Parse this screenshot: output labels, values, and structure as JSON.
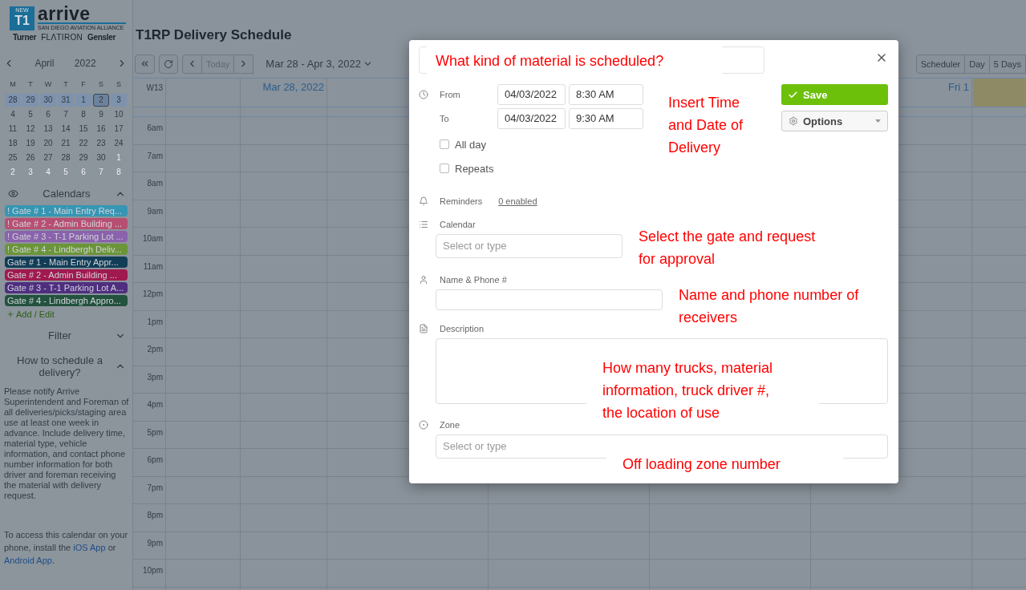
{
  "header": {
    "logo": {
      "badge_top": "NEW",
      "badge": "T1",
      "name": "arrive",
      "tagline": "SAN DIEGO AVIATION ALLIANCE",
      "partners": [
        "Turner",
        "FLΛTIRON",
        "Gensler"
      ]
    },
    "title": "T1RP Delivery Schedule"
  },
  "mini_calendar": {
    "month": "April",
    "year": "2022",
    "weekdays": [
      "M",
      "T",
      "W",
      "T",
      "F",
      "S",
      "S"
    ],
    "weeks": [
      {
        "current": true,
        "days": [
          {
            "d": "28",
            "muted": false,
            "selected": false
          },
          {
            "d": "29",
            "muted": false,
            "selected": false
          },
          {
            "d": "30",
            "muted": false,
            "selected": false
          },
          {
            "d": "31",
            "muted": false,
            "selected": false
          },
          {
            "d": "1",
            "muted": false,
            "selected": false
          },
          {
            "d": "2",
            "muted": false,
            "selected": true
          },
          {
            "d": "3",
            "muted": false,
            "selected": false
          }
        ]
      },
      {
        "current": false,
        "days": [
          {
            "d": "4",
            "muted": false,
            "selected": false
          },
          {
            "d": "5",
            "muted": false,
            "selected": false
          },
          {
            "d": "6",
            "muted": false,
            "selected": false
          },
          {
            "d": "7",
            "muted": false,
            "selected": false
          },
          {
            "d": "8",
            "muted": false,
            "selected": false
          },
          {
            "d": "9",
            "muted": false,
            "selected": false
          },
          {
            "d": "10",
            "muted": false,
            "selected": false
          }
        ]
      },
      {
        "current": false,
        "days": [
          {
            "d": "11",
            "muted": false,
            "selected": false
          },
          {
            "d": "12",
            "muted": false,
            "selected": false
          },
          {
            "d": "13",
            "muted": false,
            "selected": false
          },
          {
            "d": "14",
            "muted": false,
            "selected": false
          },
          {
            "d": "15",
            "muted": false,
            "selected": false
          },
          {
            "d": "16",
            "muted": false,
            "selected": false
          },
          {
            "d": "17",
            "muted": false,
            "selected": false
          }
        ]
      },
      {
        "current": false,
        "days": [
          {
            "d": "18",
            "muted": false,
            "selected": false
          },
          {
            "d": "19",
            "muted": false,
            "selected": false
          },
          {
            "d": "20",
            "muted": false,
            "selected": false
          },
          {
            "d": "21",
            "muted": false,
            "selected": false
          },
          {
            "d": "22",
            "muted": false,
            "selected": false
          },
          {
            "d": "23",
            "muted": false,
            "selected": false
          },
          {
            "d": "24",
            "muted": false,
            "selected": false
          }
        ]
      },
      {
        "current": false,
        "days": [
          {
            "d": "25",
            "muted": false,
            "selected": false
          },
          {
            "d": "26",
            "muted": false,
            "selected": false
          },
          {
            "d": "27",
            "muted": false,
            "selected": false
          },
          {
            "d": "28",
            "muted": false,
            "selected": false
          },
          {
            "d": "29",
            "muted": false,
            "selected": false
          },
          {
            "d": "30",
            "muted": false,
            "selected": false
          },
          {
            "d": "1",
            "muted": true,
            "selected": false
          }
        ]
      },
      {
        "current": false,
        "days": [
          {
            "d": "2",
            "muted": true,
            "selected": false
          },
          {
            "d": "3",
            "muted": true,
            "selected": false
          },
          {
            "d": "4",
            "muted": true,
            "selected": false
          },
          {
            "d": "5",
            "muted": true,
            "selected": false
          },
          {
            "d": "6",
            "muted": true,
            "selected": false
          },
          {
            "d": "7",
            "muted": true,
            "selected": false
          },
          {
            "d": "8",
            "muted": true,
            "selected": false
          }
        ]
      }
    ]
  },
  "calendars": {
    "title": "Calendars",
    "expanded": true,
    "items": [
      {
        "label": "! Gate # 1 - Main Entry Req...",
        "color": "#3596b4"
      },
      {
        "label": "! Gate # 2 - Admin Building ...",
        "color": "#b84f73"
      },
      {
        "label": "! Gate # 3 - T-1 Parking Lot ...",
        "color": "#8a62ad"
      },
      {
        "label": "! Gate # 4 - Lindbergh Deliv...",
        "color": "#6b9538"
      },
      {
        "label": "Gate # 1 - Main Entry Appr...",
        "color": "#123d57"
      },
      {
        "label": "Gate # 2 - Admin Building ...",
        "color": "#a0194f"
      },
      {
        "label": "Gate # 3 - T-1 Parking Lot A...",
        "color": "#4f2e80"
      },
      {
        "label": "Gate # 4 - Lindbergh Appro...",
        "color": "#23523f"
      }
    ],
    "add_label": "Add / Edit"
  },
  "filter": {
    "title": "Filter",
    "expanded": false
  },
  "help": {
    "title": "How to schedule a delivery?",
    "expanded": true,
    "text": "Please notify Arrive Superintendent and Foreman of all deliveries/picks/staging area use at least one week in advance. Include delivery time, material type, vehicle information, and contact phone number information for both driver and foreman receiving the material with delivery request.",
    "access": [
      {
        "kind": "text",
        "text": "To access this calendar on your phone, install the "
      },
      {
        "kind": "link",
        "text": "iOS App"
      },
      {
        "kind": "text",
        "text": " or "
      },
      {
        "kind": "link",
        "text": "Android App"
      },
      {
        "kind": "text",
        "text": "."
      }
    ]
  },
  "toolbar": {
    "today": {
      "label": "Today",
      "disabled": true
    },
    "range": "Mar 28 - Apr 3, 2022",
    "views": [
      {
        "label": "Scheduler",
        "selected": false
      },
      {
        "label": "Day",
        "selected": false
      },
      {
        "label": "5 Days",
        "selected": false
      }
    ]
  },
  "grid": {
    "week": "W13",
    "days": [
      {
        "label": "Mar 28, 2022",
        "today": false
      },
      {
        "today": false
      },
      {
        "label": "Fri 1",
        "today": false
      },
      {
        "today": true
      }
    ],
    "hours": [
      "6am",
      "7am",
      "8am",
      "9am",
      "10am",
      "11am",
      "12pm",
      "1pm",
      "2pm",
      "3pm",
      "4pm",
      "5pm",
      "6pm",
      "7pm",
      "8pm",
      "9pm",
      "10pm"
    ]
  },
  "modal": {
    "when": [
      {
        "label": "From",
        "date": "04/03/2022",
        "time": "8:30 AM"
      },
      {
        "label": "To",
        "date": "04/03/2022",
        "time": "9:30 AM"
      }
    ],
    "options": [
      {
        "label": "All day",
        "checked": false
      },
      {
        "label": "Repeats",
        "checked": false
      }
    ],
    "reminders": {
      "label": "Reminders",
      "link": "0 enabled"
    },
    "calendar": {
      "label": "Calendar",
      "placeholder": "Select or type"
    },
    "name_phone": {
      "label": "Name & Phone #"
    },
    "description": {
      "label": "Description"
    },
    "zone": {
      "label": "Zone",
      "placeholder": "Select or type"
    },
    "save": "Save",
    "more": "Options",
    "annotations": [
      "What kind of material is scheduled?",
      "Insert Time and Date of Delivery",
      "Select the gate and request for approval",
      "Name and phone number of receivers",
      "How many trucks, material information, truck driver #, the location of use",
      "Off loading zone number"
    ]
  }
}
